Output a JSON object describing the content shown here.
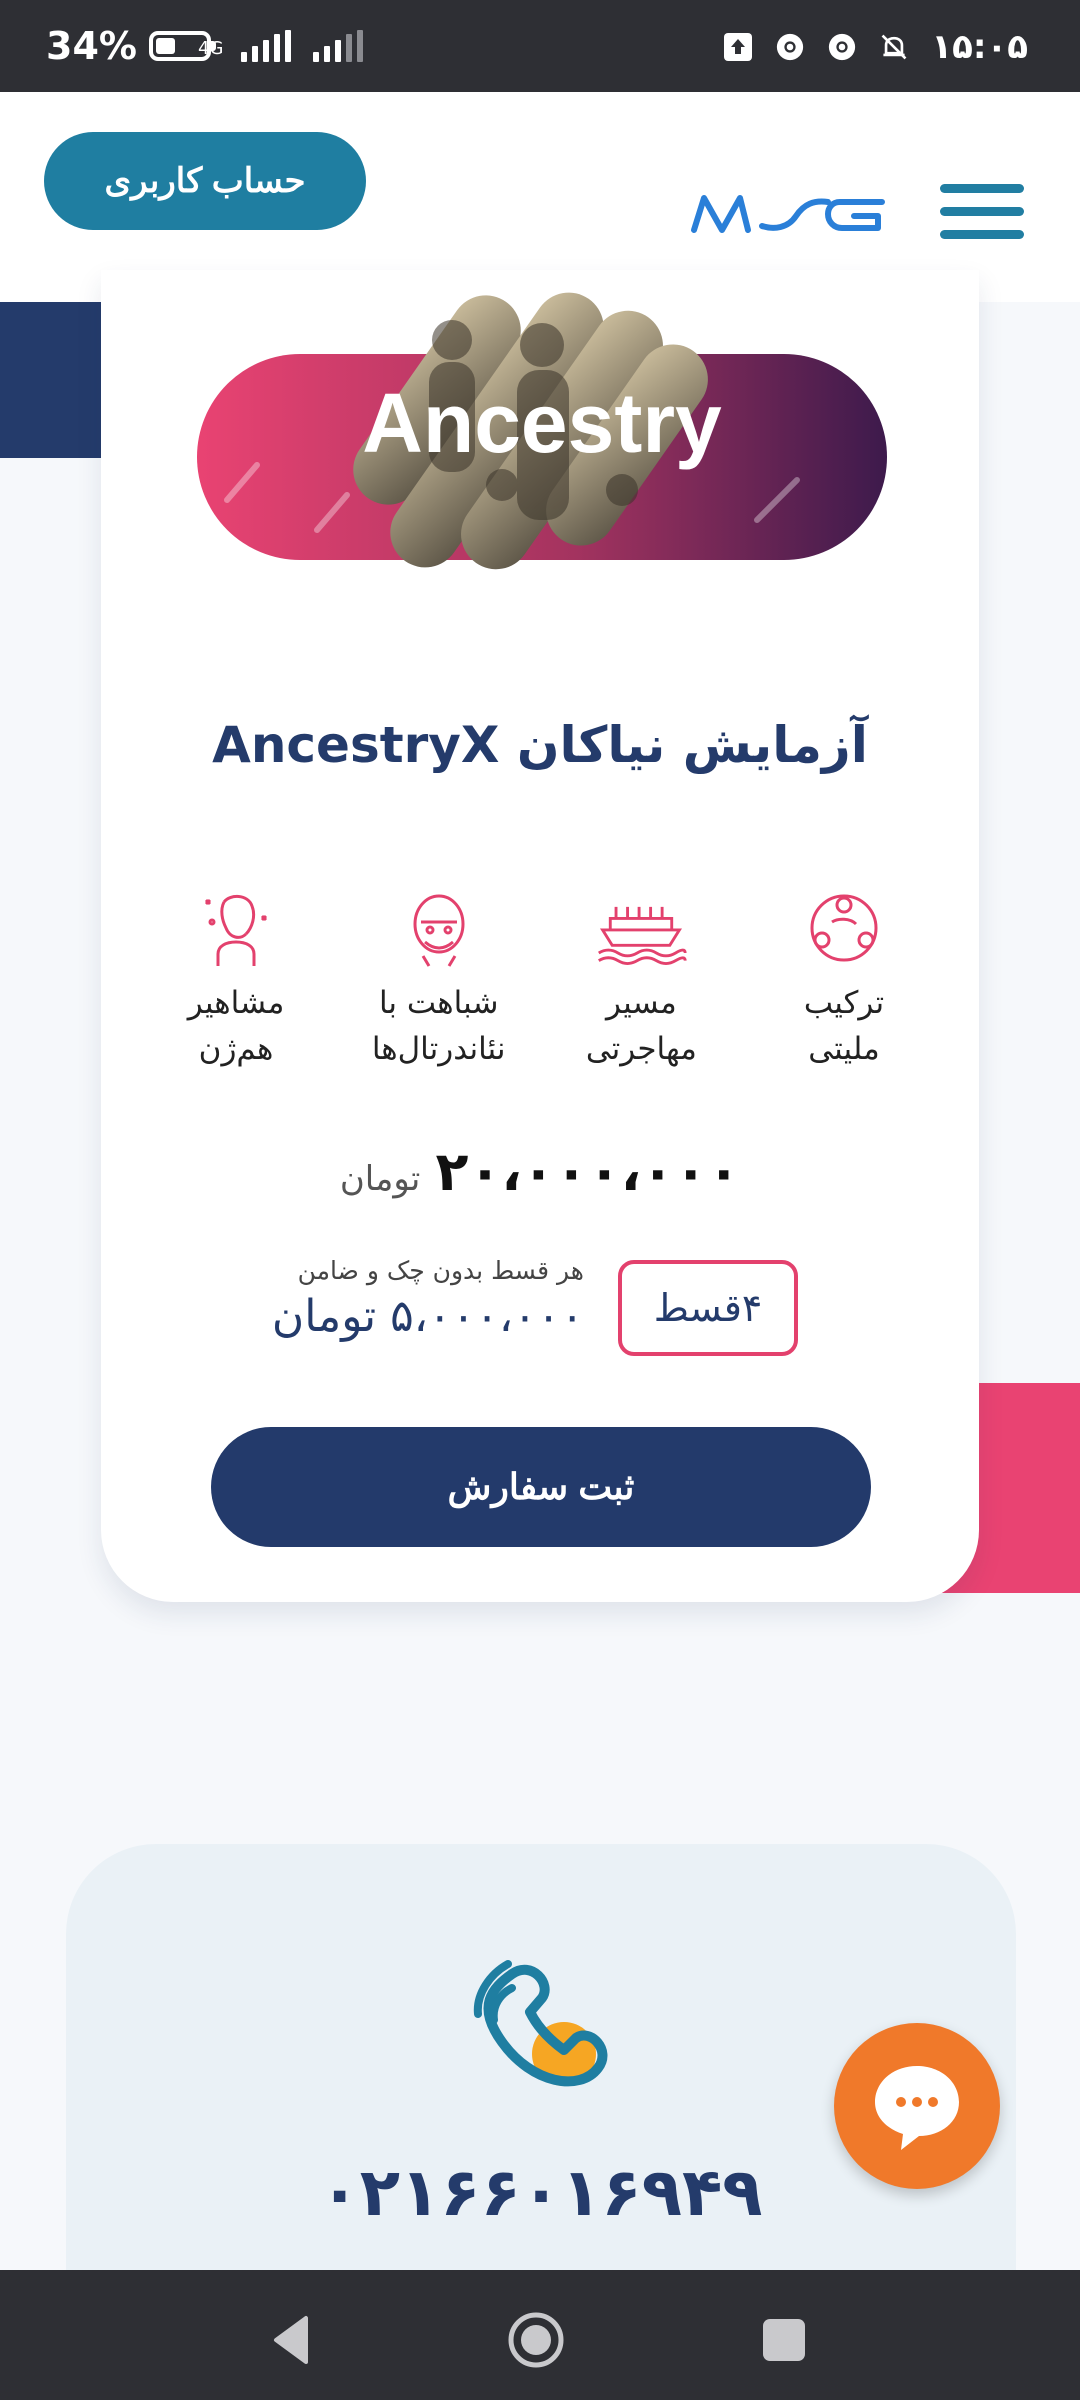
{
  "status_bar": {
    "battery_text": "34%",
    "network_label": "4G",
    "time": "۱۵:۰۵",
    "icons": [
      "upload-icon",
      "chrome-icon",
      "chrome-icon",
      "notifications-off-icon"
    ]
  },
  "header": {
    "account_button_label": "حساب کاربری",
    "logo_text": "MSG"
  },
  "product": {
    "banner_text": "Ancestry",
    "title": "آزمایش نیاکان AncestryX",
    "features": [
      {
        "icon": "ethnicity-globe-icon",
        "label_line1": "ترکیب",
        "label_line2": "ملیتی"
      },
      {
        "icon": "migration-ship-icon",
        "label_line1": "مسیر",
        "label_line2": "مهاجرتی"
      },
      {
        "icon": "neanderthal-face-icon",
        "label_line1": "شباهت با",
        "label_line2": "نئاندرتال‌ها"
      },
      {
        "icon": "famous-relatives-icon",
        "label_line1": "مشاهیر",
        "label_line2": "هم‌ژن"
      }
    ],
    "price_value": "۲۰،۰۰۰،۰۰۰",
    "price_unit": "تومان",
    "installment_badge": "۴قسط",
    "installment_note": "هر قسط بدون چک و ضامن",
    "installment_amount": "۵،۰۰۰،۰۰۰ تومان",
    "order_button_label": "ثبت سفارش"
  },
  "contact": {
    "phone_number": "۰۲۱۶۶۰۱۶۹۴۹"
  },
  "colors": {
    "navy": "#243b6b",
    "teal": "#1f7ea1",
    "pink": "#e3416d",
    "orange": "#f0792a"
  }
}
